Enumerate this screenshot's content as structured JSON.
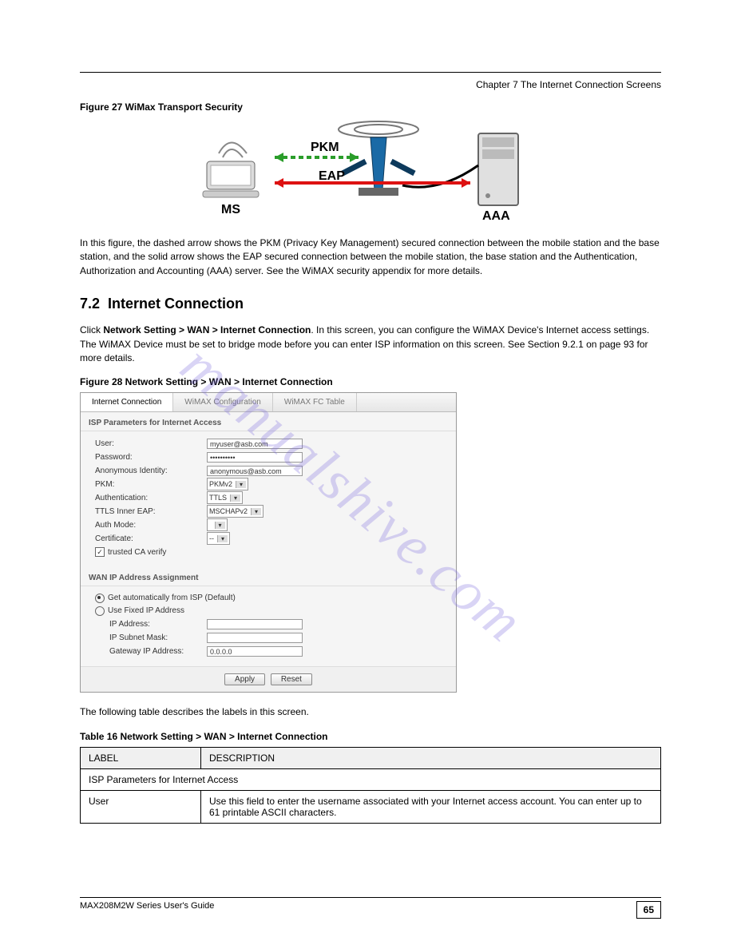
{
  "header": {
    "right": "Chapter 7 The Internet Connection Screens"
  },
  "caption1": "Figure 27   WiMax Transport Security",
  "diagram": {
    "pkm": "PKM",
    "eap": "EAP",
    "ms": "MS",
    "aaa": "AAA"
  },
  "para1": "In this figure, the dashed arrow shows the PKM (Privacy Key Management) secured connection between the mobile station and the base station, and the solid arrow shows the EAP secured connection between the mobile station, the base station and the Authentication, Authorization and Accounting (AAA) server. See the WiMAX security appendix for more details.",
  "section": {
    "num": "7.2",
    "title": "Internet Connection"
  },
  "para2_a": "Click ",
  "para2_b": "Network Setting > WAN > Internet Connection",
  "para2_c": ". In this screen, you can configure the WiMAX Device's Internet access settings. The WiMAX Device must be set to bridge mode before you can enter ISP information on this screen. See Section 9.2.1 on page 93 for more details.",
  "caption2": "Figure 28   Network Setting > WAN > Internet Connection",
  "screenshot": {
    "tabs": [
      "Internet Connection",
      "WiMAX Configuration",
      "WiMAX FC Table"
    ],
    "panel1_title": "ISP Parameters for Internet Access",
    "fields": {
      "user_label": "User:",
      "user_value": "myuser@asb.com",
      "password_label": "Password:",
      "password_value": "••••••••••",
      "anon_label": "Anonymous Identity:",
      "anon_value": "anonymous@asb.com",
      "pkm_label": "PKM:",
      "pkm_value": "PKMv2",
      "auth_label": "Authentication:",
      "auth_value": "TTLS",
      "ttls_label": "TTLS Inner EAP:",
      "ttls_value": "MSCHAPv2",
      "authmode_label": "Auth Mode:",
      "cert_label": "Certificate:",
      "cert_value": "--",
      "trusted_label": "trusted CA verify"
    },
    "panel2_title": "WAN IP Address Assignment",
    "wan": {
      "auto": "Get automatically from ISP (Default)",
      "fixed": "Use Fixed IP Address",
      "ip_label": "IP Address:",
      "mask_label": "IP Subnet Mask:",
      "gw_label": "Gateway IP Address:",
      "gw_value": "0.0.0.0"
    },
    "buttons": {
      "apply": "Apply",
      "reset": "Reset"
    }
  },
  "para3": "The following table describes the labels in this screen.",
  "table_caption": "Table 16   Network Setting > WAN > Internet Connection",
  "table": {
    "h1": "LABEL",
    "h2": "DESCRIPTION",
    "row1": "ISP Parameters for Internet Access",
    "row2_label": "User",
    "row2_desc": "Use this field to enter the username associated with your Internet access account. You can enter up to 61 printable ASCII characters."
  },
  "footer": {
    "left": "MAX208M2W Series User's Guide",
    "pagenum": "65"
  },
  "watermark": "manualshive.com"
}
